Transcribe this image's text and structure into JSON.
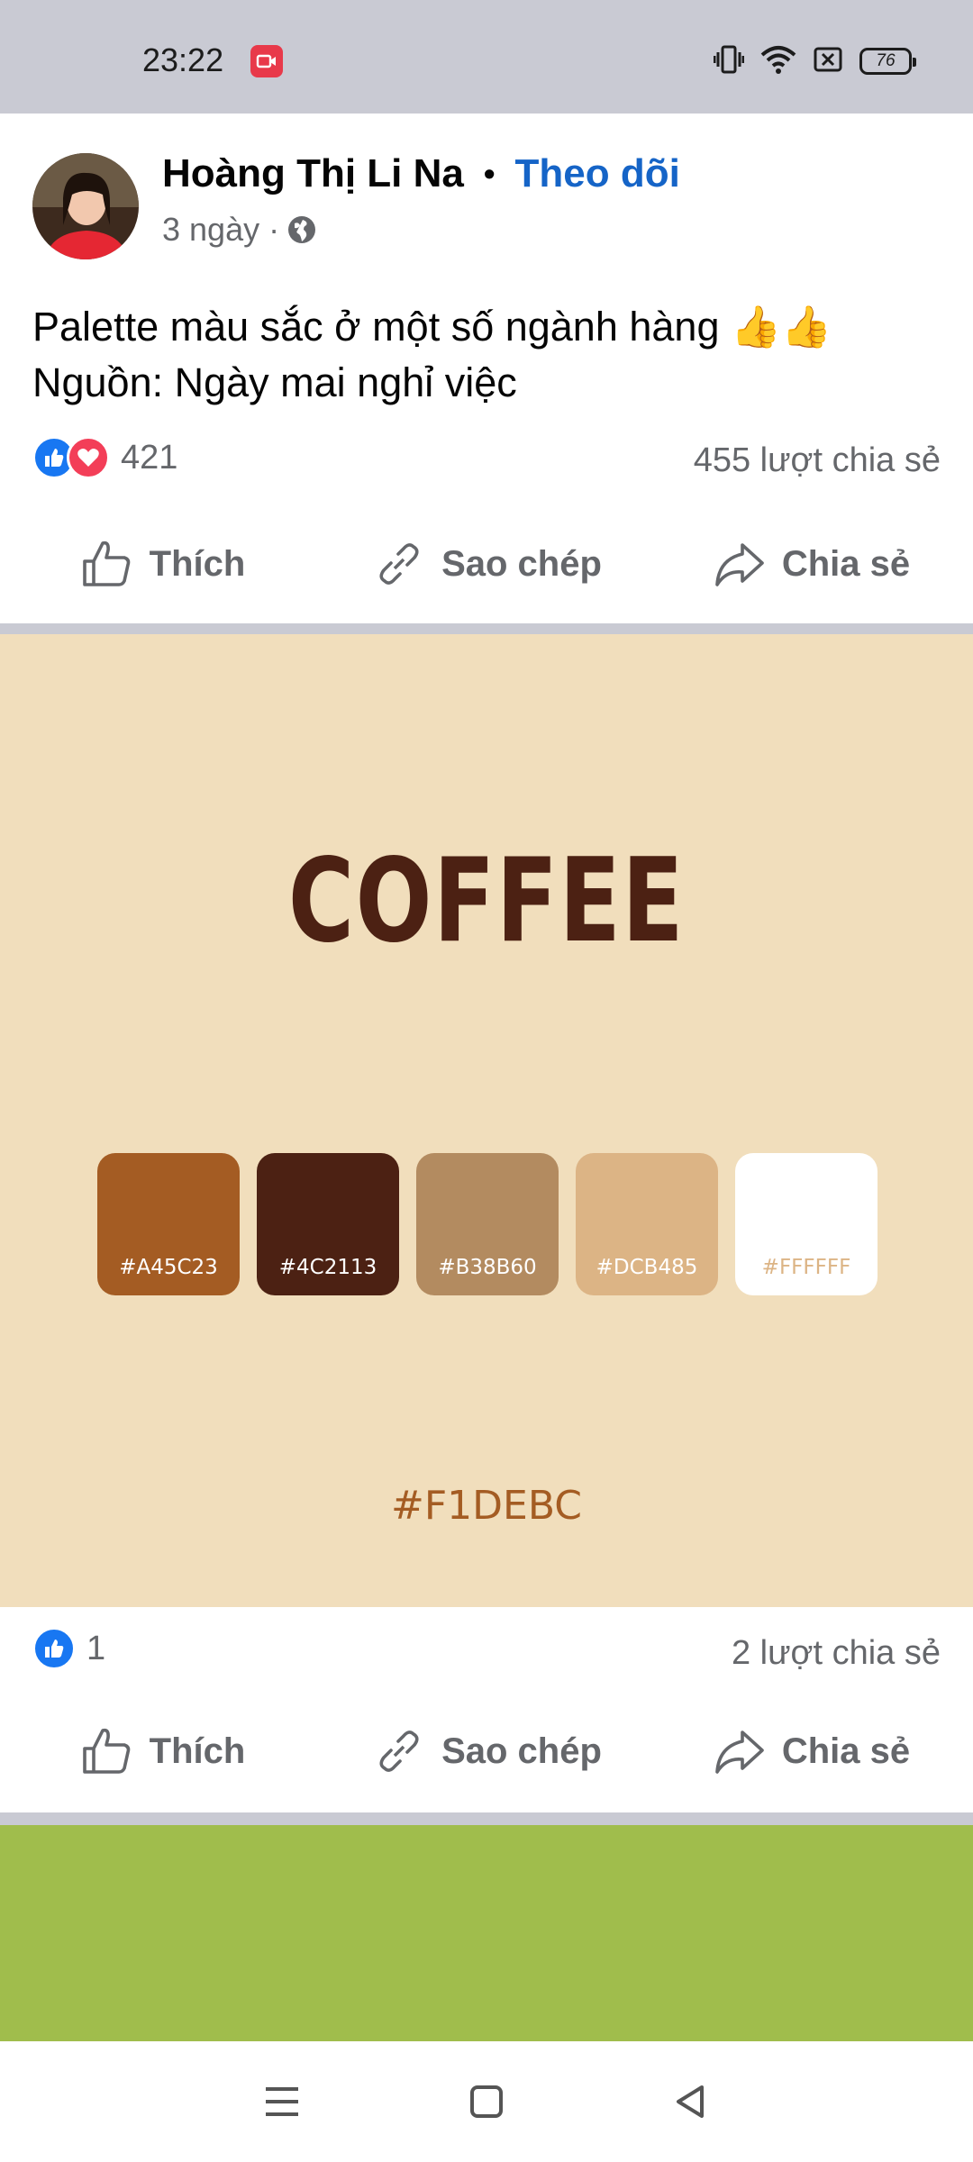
{
  "status_bar": {
    "time": "23:22",
    "battery": "76"
  },
  "post": {
    "author": "Hoàng Thị Li Na",
    "separator": "•",
    "follow_label": "Theo dõi",
    "time_ago": "3 ngày ·",
    "text_line1": "Palette màu sắc ở một số ngành hàng 👍👍",
    "text_line2": "Nguồn: Ngày mai nghỉ việc",
    "reaction_count": "421",
    "share_count": "455 lượt chia sẻ"
  },
  "actions": {
    "like": "Thích",
    "copy": "Sao chép",
    "share": "Chia sẻ"
  },
  "palette": {
    "title": "COFFEE",
    "swatches": [
      {
        "code": "#A45C23",
        "color": "#A45C23",
        "text_color": "#ffffff"
      },
      {
        "code": "#4C2113",
        "color": "#4C2113",
        "text_color": "#ffffff"
      },
      {
        "code": "#B38B60",
        "color": "#B38B60",
        "text_color": "#ffffff"
      },
      {
        "code": "#DCB485",
        "color": "#DCB485",
        "text_color": "#ffffff"
      },
      {
        "code": "#FFFFFF",
        "color": "#FFFFFF",
        "text_color": "#DCB485"
      }
    ],
    "background_code": "#F1DEBC"
  },
  "post2": {
    "reaction_count": "1",
    "share_count": "2 lượt chia sẻ"
  },
  "nav": {
    "icons": [
      "menu-icon",
      "home-square-icon",
      "back-triangle-icon"
    ]
  },
  "colors": {
    "accent": "#1564c7",
    "like_blue": "#1877f2",
    "love_red": "#f33e58",
    "palette_bg": "#f1debc",
    "next_post_green": "#a0bd4c"
  }
}
